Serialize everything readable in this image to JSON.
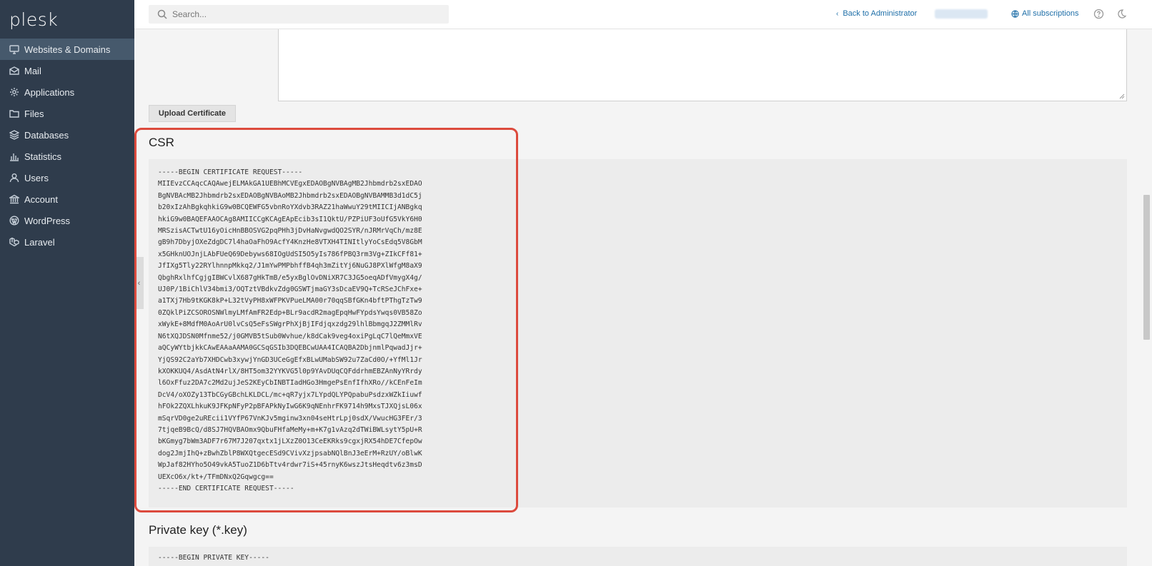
{
  "app": {
    "logo": "plesk"
  },
  "sidebar": {
    "items": [
      {
        "label": "Websites & Domains",
        "icon": "monitor-icon",
        "active": true
      },
      {
        "label": "Mail",
        "icon": "mail-icon"
      },
      {
        "label": "Applications",
        "icon": "gear-icon"
      },
      {
        "label": "Files",
        "icon": "folder-icon"
      },
      {
        "label": "Databases",
        "icon": "layers-icon"
      },
      {
        "label": "Statistics",
        "icon": "bar-chart-icon"
      },
      {
        "label": "Users",
        "icon": "user-icon"
      },
      {
        "label": "Account",
        "icon": "bank-icon"
      },
      {
        "label": "WordPress",
        "icon": "wordpress-icon"
      },
      {
        "label": "Laravel",
        "icon": "laravel-icon"
      }
    ]
  },
  "header": {
    "search_placeholder": "Search...",
    "back_link": "Back to Administrator",
    "subscriptions_link": "All subscriptions"
  },
  "main": {
    "upload_button": "Upload Certificate",
    "csr": {
      "title": "CSR",
      "content": "-----BEGIN CERTIFICATE REQUEST-----\nMIIEvzCCAqcCAQAwejELMAkGA1UEBhMCVEgxEDAOBgNVBAgMB2Jhbmdrb2sxEDAO\nBgNVBAcMB2Jhbmdrb2sxEDAOBgNVBAoMB2Jhbmdrb2sxEDAOBgNVBAMMB3d1dC5j\nb20xIzAhBgkqhkiG9w0BCQEWFG5vbnRoYXdvb3RAZ21haWwuY29tMIICIjANBgkq\nhkiG9w0BAQEFAAOCAg8AMIICCgKCAgEApEcib3sI1QktU/PZPiUF3oUfG5VkY6H0\nMRSzisACTwtU16yOicHnBBOSVG2pqPHh3jDvHaNvgwdQO2SYR/nJRMrVqCh/mz8E\ngB9h7DbyjOXeZdgDC7l4haOaFhO9AcfY4KnzHe8VTXH4TINItlyYoCsEdq5V8GbM\nx5GHknUOJnjLAbFUeQ69Debyws68IOgUdSI5O5yIs786fPBQ3rm3Vg+ZIkCFf81+\nJfIXg5Tly22RYlhnnpMkkq2/J1mYwPMPbhffB4qh3mZitYj6NuGJ8PXlWfgM8aX9\nQbghRxlhfCgjgIBWCvlX687gHkTmB/e5yxBglOvDNiXR7C3JG5oeqADfVmygX4g/\nUJ0P/1BiChlV34bmi3/OQTztVBdkvZdg0GSWTjmaGY3sDcaEV9Q+TcRSeJChFxe+\na1TXj7Hb9tKGK8kP+L32tVyPH8xWFPKVPueLMA00r70qqSBfGKn4bftPThgTzTw9\n0ZQklPiZCSOROSNWlmyLMfAmFR2Edp+BLr9acdR2magEpqHwFYpdsYwqs0VB58Zo\nxWykE+8MdfM0AoArU0lvCsQ5eFsSWgrPhXjBjIFdjqxzdg29lhlBbmgqJ2ZMMlRv\nN6tXQJDSN0Mfnme52/j0GMVB5tSub0Wvhue/k8dCak9veg4oxiPgLqC7lQeMmxVE\naQCyWYtbjkkCAwEAAaAAMA0GCSqGSIb3DQEBCwUAA4ICAQBA2DbjnmlPqwadJjr+\nYjQS92C2aYb7XHDCwb3xywjYnGD3UCeGgEfxBLwUMabSW92u7ZaCd0O/+YfMl1Jr\nkXOKKUQ4/AsdAtN4rlX/8HT5om32YYKVG5l0p9YAvDUqCQFddrhmEBZAnNyYRrdy\nl6OxFfuz2DA7c2Md2ujJeS2KEyCbINBTIadHGo3HmgePsEnfIfhXRo//kCEnFeIm\nDcV4/oXOZy13TbCGyGBchLKLDCL/mc+qR7yjx7LYpdQLYPQpabuPsdzxWZkIiuwf\nhFOk2ZQXLhkuK9JFKpNFyP2pBFAPkNyIwG6K9qNEnhrFK9714h9MxsTJXQjsL06x\nmSqrVD0ge2uREcii1VYfP67VnKJv5mginw3xn04seHtrLpj0sdX/VwucHG3FEr/3\n7tjqeB9BcQ/d8SJ7HQVBAOmx9QbuFHfaMeMy+m+K7g1vAzq2dTWiBWLsytY5pU+R\nbKGmyg7bWm3ADF7r67M7J207qxtx1jLXzZ0O13CeEKRks9cgxjRX54hDE7CfepOw\ndog2JmjIhQ+zBwhZblP8WXQtgecESd9CVivXzjpsabNQlBnJ3eErM+RzUY/oBlwK\nWpJaf82HYho5O49vkA5TuoZ1D6bTtv4rdwr7iS+45rnyK6wszJtsHeqdtv6z3msD\nUEXcO6x/kt+/TFmDNxQ2Gqwgcg==\n-----END CERTIFICATE REQUEST-----"
    },
    "private_key": {
      "title": "Private key (*.key)",
      "content": "-----BEGIN PRIVATE KEY-----"
    }
  }
}
